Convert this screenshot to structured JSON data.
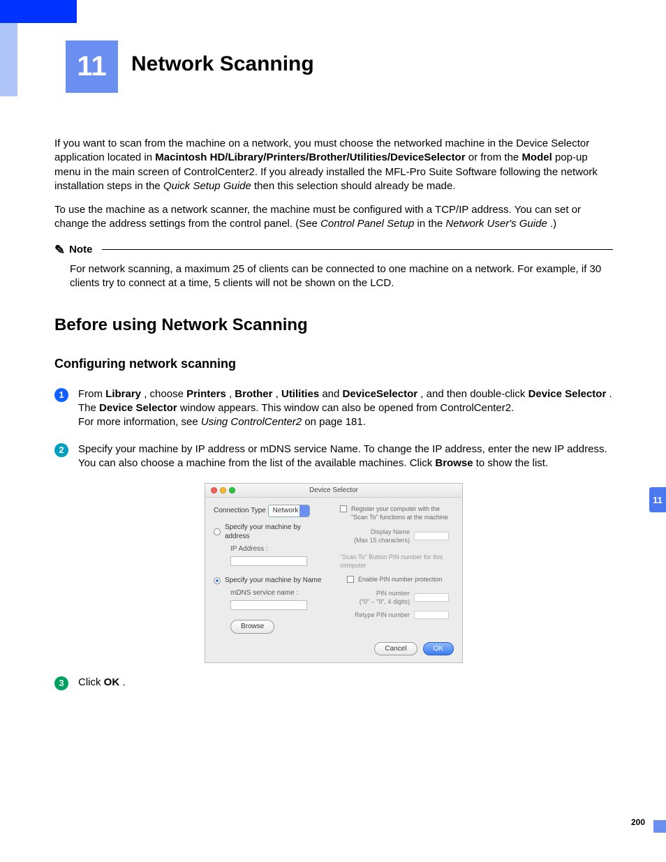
{
  "chapter": {
    "number": "11",
    "title": "Network Scanning"
  },
  "intro": {
    "p1_a": "If you want to scan from the machine on a network, you must choose the networked machine in the Device Selector application located in ",
    "p1_path": "Macintosh HD/Library/Printers/Brother/Utilities/DeviceSelector",
    "p1_b": " or from the ",
    "p1_model": "Model",
    "p1_c": " pop-up menu in the main screen of ControlCenter2. If you already installed the MFL-Pro Suite Software following the network installation steps in the ",
    "p1_qsg": "Quick Setup Guide",
    "p1_d": " then this selection should already be made.",
    "p2_a": "To use the machine as a network scanner, the machine must be configured with a TCP/IP address. You can set or change the address settings from the control panel. (See ",
    "p2_cps": "Control Panel Setup",
    "p2_b": " in the ",
    "p2_nug": "Network User's Guide",
    "p2_c": ".)"
  },
  "note": {
    "label": "Note",
    "body": "For network scanning, a maximum 25 of clients can be connected to one machine on a network. For example, if 30 clients try to connect at a time, 5 clients will not be shown on the LCD."
  },
  "h2": "Before using Network Scanning",
  "h3": "Configuring network scanning",
  "steps": {
    "s1": {
      "a": "From ",
      "library": "Library",
      "b": ", choose ",
      "printers": "Printers",
      "c": ", ",
      "brother": "Brother",
      "d": ", ",
      "utilities": "Utilities",
      "e": " and ",
      "deviceselector": "DeviceSelector",
      "f": ", and then double-click ",
      "devsel2": "Device Selector",
      "g": ".",
      "line2a": "The ",
      "line2b": "Device Selector",
      "line2c": " window appears. This window can also be opened from ControlCenter2.",
      "line3a": "For more information, see ",
      "line3i": "Using ControlCenter2",
      "line3b": " on page 181."
    },
    "s2": {
      "a": "Specify your machine by IP address or mDNS service Name. To change the IP address, enter the new IP address. You can also choose a machine from the list of the available machines. Click ",
      "browse": "Browse",
      "b": " to show the list."
    },
    "s3": {
      "a": "Click ",
      "ok": "OK",
      "b": "."
    }
  },
  "ds": {
    "title": "Device Selector",
    "conn_type_label": "Connection Type",
    "conn_type_value": "Network",
    "radio_addr": "Specify your machine by address",
    "ip_label": "IP Address :",
    "radio_name": "Specify your machine by Name",
    "mdns_label": "mDNS service name :",
    "browse": "Browse",
    "register_label": "Register your computer with the \"Scan To\" functions at the machine",
    "display_name": "Display Name",
    "display_hint": "(Max 15 characters)",
    "scan_to_hint": "\"Scan To\" Button PIN number for this computer",
    "enable_pin": "Enable PIN number protection",
    "pin_label": "PIN number",
    "pin_hint": "(\"0\" – \"9\",  4 digits)",
    "retype_label": "Retype PIN number",
    "cancel": "Cancel",
    "ok": "OK"
  },
  "side_tab": "11",
  "page_number": "200"
}
